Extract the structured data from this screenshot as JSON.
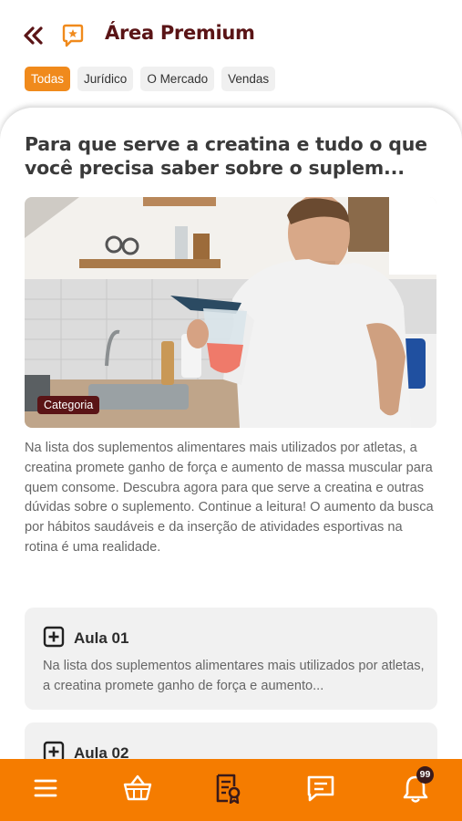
{
  "header": {
    "title": "Área Premium",
    "back_icon": "double-chevron-left-icon",
    "section_icon": "star-badge-icon"
  },
  "filters": [
    "Todas",
    "Jurídico",
    "O Mercado",
    "Vendas"
  ],
  "article": {
    "title": "Para que serve a creatina e tudo o que você precisa saber sobre o suplem...",
    "category": "Categoria",
    "body": "Na lista dos suplementos alimentares mais utilizados por atletas, a creatina promete ganho de força e aumento de massa muscular para quem consome. Descubra agora para que serve a creatina e outras dúvidas sobre o suplemento. Continue a leitura! O aumento da busca por hábitos saudáveis e da inserção de atividades esportivas na rotina é uma realidade."
  },
  "lessons": [
    {
      "title": "Aula 01",
      "description": "Na lista dos suplementos alimentares mais utilizados por atletas, a creatina promete ganho de força e aumento..."
    },
    {
      "title": "Aula 02",
      "description": ""
    }
  ],
  "bottom_nav": {
    "items": [
      "menu-icon",
      "basket-icon",
      "certificate-icon",
      "chat-icon",
      "bell-icon"
    ],
    "notification_count": "99"
  },
  "colors": {
    "accent_orange": "#f57c00",
    "chip_active": "#f08a1c",
    "title_maroon": "#5a1416"
  }
}
